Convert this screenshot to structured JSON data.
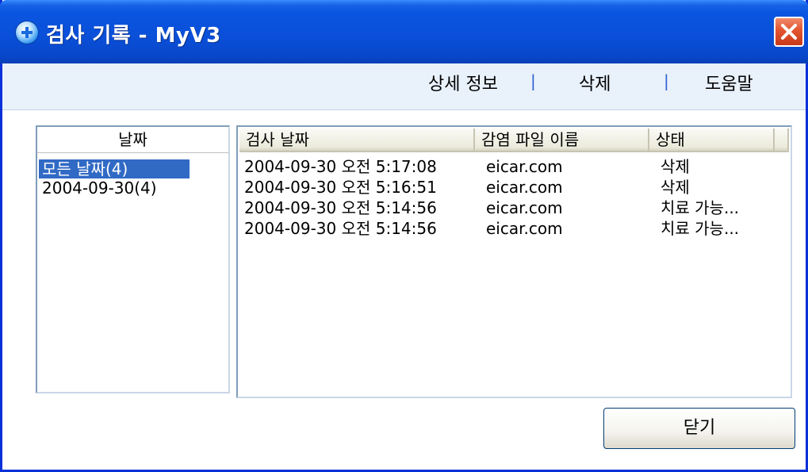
{
  "window": {
    "title": "검사 기록 - MyV3"
  },
  "menu": {
    "details": "상세 정보",
    "delete": "삭제",
    "help": "도움말",
    "separator": "|"
  },
  "date_panel": {
    "header": "날짜",
    "items": [
      {
        "label": "모든 날짜(4)",
        "selected": true
      },
      {
        "label": "2004-09-30(4)",
        "selected": false
      }
    ]
  },
  "log_table": {
    "columns": [
      "검사 날짜",
      "감염 파일 이름",
      "상태"
    ],
    "rows": [
      {
        "date": "2004-09-30 오전 5:17:08",
        "file": "eicar.com",
        "status": "삭제"
      },
      {
        "date": "2004-09-30 오전 5:16:51",
        "file": "eicar.com",
        "status": "삭제"
      },
      {
        "date": "2004-09-30 오전 5:14:56",
        "file": "eicar.com",
        "status": "치료 가능..."
      },
      {
        "date": "2004-09-30 오전 5:14:56",
        "file": "eicar.com",
        "status": "치료 가능..."
      }
    ]
  },
  "buttons": {
    "close": "닫기"
  },
  "colors": {
    "titlebar": "#0a55e0",
    "selection": "#316ac5",
    "close_button": "#e2542f"
  }
}
